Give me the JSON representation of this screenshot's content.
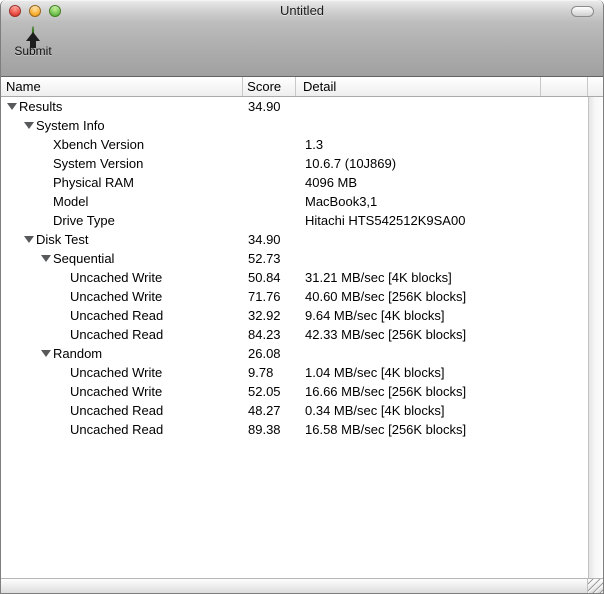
{
  "window": {
    "title": "Untitled"
  },
  "titlebar": {
    "buttons": [
      "close",
      "minimize",
      "zoom"
    ],
    "toolbar_toggle": "pill-button"
  },
  "toolbar": {
    "submit": {
      "label": "Submit",
      "icon": "green-circle-up-arrow"
    }
  },
  "table": {
    "columns": [
      {
        "label": "Name"
      },
      {
        "label": "Score"
      },
      {
        "label": "Detail"
      }
    ],
    "rows": [
      {
        "level": 0,
        "expanded": true,
        "name": "Results",
        "score": "34.90",
        "detail": ""
      },
      {
        "level": 1,
        "expanded": true,
        "name": "System Info",
        "score": "",
        "detail": ""
      },
      {
        "level": 2,
        "expanded": false,
        "name": "Xbench Version",
        "score": "",
        "detail": "1.3"
      },
      {
        "level": 2,
        "expanded": false,
        "name": "System Version",
        "score": "",
        "detail": "10.6.7 (10J869)"
      },
      {
        "level": 2,
        "expanded": false,
        "name": "Physical RAM",
        "score": "",
        "detail": "4096 MB"
      },
      {
        "level": 2,
        "expanded": false,
        "name": "Model",
        "score": "",
        "detail": "MacBook3,1"
      },
      {
        "level": 2,
        "expanded": false,
        "name": "Drive Type",
        "score": "",
        "detail": "Hitachi HTS542512K9SA00"
      },
      {
        "level": 1,
        "expanded": true,
        "name": "Disk Test",
        "score": "34.90",
        "detail": ""
      },
      {
        "level": 2,
        "expanded": true,
        "name": "Sequential",
        "score": "52.73",
        "detail": ""
      },
      {
        "level": 3,
        "expanded": false,
        "name": "Uncached Write",
        "score": "50.84",
        "detail": "31.21 MB/sec [4K blocks]"
      },
      {
        "level": 3,
        "expanded": false,
        "name": "Uncached Write",
        "score": "71.76",
        "detail": "40.60 MB/sec [256K blocks]"
      },
      {
        "level": 3,
        "expanded": false,
        "name": "Uncached Read",
        "score": "32.92",
        "detail": "9.64 MB/sec [4K blocks]"
      },
      {
        "level": 3,
        "expanded": false,
        "name": "Uncached Read",
        "score": "84.23",
        "detail": "42.33 MB/sec [256K blocks]"
      },
      {
        "level": 2,
        "expanded": true,
        "name": "Random",
        "score": "26.08",
        "detail": ""
      },
      {
        "level": 3,
        "expanded": false,
        "name": "Uncached Write",
        "score": "9.78",
        "detail": "1.04 MB/sec [4K blocks]"
      },
      {
        "level": 3,
        "expanded": false,
        "name": "Uncached Write",
        "score": "52.05",
        "detail": "16.66 MB/sec [256K blocks]"
      },
      {
        "level": 3,
        "expanded": false,
        "name": "Uncached Read",
        "score": "48.27",
        "detail": "0.34 MB/sec [4K blocks]"
      },
      {
        "level": 3,
        "expanded": false,
        "name": "Uncached Read",
        "score": "89.38",
        "detail": "16.58 MB/sec [256K blocks]"
      }
    ]
  },
  "colors": {
    "submit_green": "#6fce3a",
    "disclosure_triangle": "#58595b",
    "toolbar_gray": "#a9a9a9"
  }
}
